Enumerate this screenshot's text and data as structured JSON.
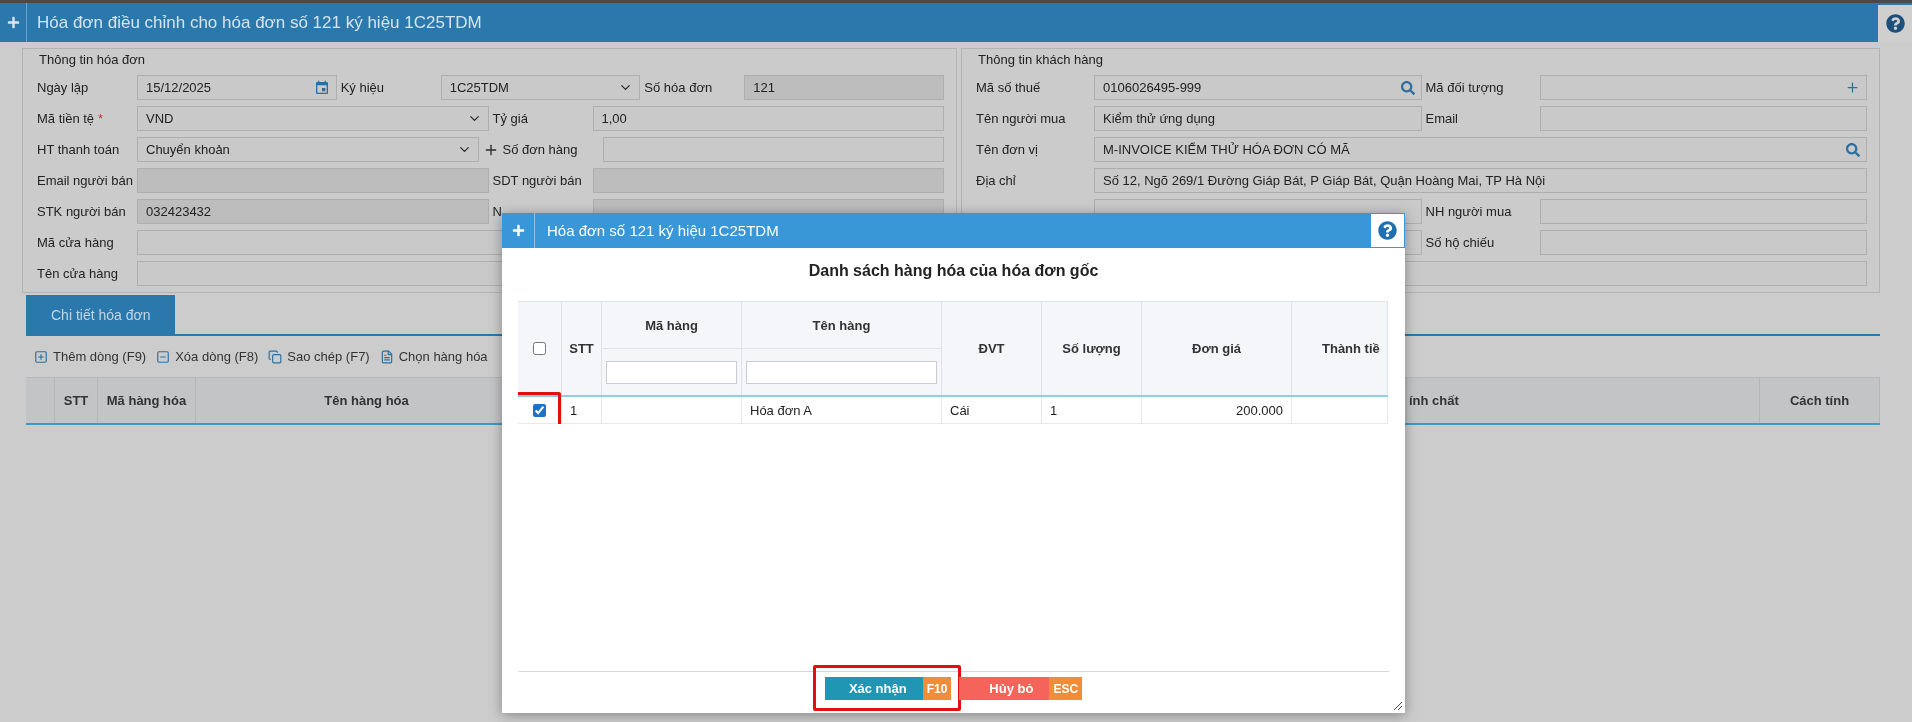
{
  "header": {
    "title": "Hóa đơn điều chỉnh cho hóa đơn số 121 ký hiệu 1C25TDM"
  },
  "invoice_info": {
    "legend": "Thông tin hóa đơn",
    "rows": [
      [
        {
          "label": "Ngày lập",
          "value": "15/12/2025",
          "kind": "date",
          "disabled": false
        },
        {
          "label": "Ký hiệu",
          "value": "1C25TDM",
          "kind": "select",
          "disabled": false
        },
        {
          "label": "Số hóa đơn",
          "value": "121",
          "kind": "text",
          "disabled": true
        }
      ],
      [
        {
          "label": "Mã tiền tệ",
          "required_mark": "*",
          "value": "VND",
          "kind": "select",
          "disabled": false
        },
        {
          "label": "Tỷ giá",
          "value": "1,00",
          "kind": "text",
          "disabled": false
        }
      ],
      [
        {
          "label": "HT thanh toán",
          "value": "Chuyển khoản",
          "kind": "select_add",
          "disabled": false
        },
        {
          "label": "Số đơn hàng",
          "kind": "text",
          "disabled": false
        }
      ],
      [
        {
          "label": "Email người bán",
          "kind": "text",
          "disabled": true
        },
        {
          "label": "SDT người bán",
          "kind": "text",
          "disabled": true
        }
      ],
      [
        {
          "label": "STK người bán",
          "value": "032423432",
          "kind": "text",
          "disabled": true
        },
        {
          "label": "N",
          "kind": "text",
          "disabled": true
        }
      ],
      [
        {
          "label": "Mã cửa hàng",
          "kind": "text",
          "disabled": false
        }
      ],
      [
        {
          "label": "Tên cửa hàng",
          "kind": "text",
          "disabled": false
        }
      ]
    ]
  },
  "customer_info": {
    "legend": "Thông tin khách hàng",
    "rows": [
      [
        {
          "label": "Mã số thuế",
          "value": "0106026495-999",
          "kind": "search",
          "disabled": false
        },
        {
          "label": "Mã đối tượng",
          "kind": "add",
          "disabled": false
        }
      ],
      [
        {
          "label": "Tên người mua",
          "value": "Kiểm thử ứng dụng",
          "kind": "text",
          "disabled": false
        },
        {
          "label": "Email",
          "kind": "text",
          "disabled": false
        }
      ],
      [
        {
          "label": "Tên đơn vị",
          "value": "M-INVOICE KIỂM THỬ HÓA ĐƠN CÓ MÃ",
          "kind": "search",
          "disabled": false
        }
      ],
      [
        {
          "label": "Địa chỉ",
          "value": "Số 12, Ngõ 269/1 Đường Giáp Bát, P Giáp Bát, Quận Hoàng Mai, TP Hà Nội",
          "kind": "text",
          "disabled": false
        }
      ],
      [
        {
          "kind": "text",
          "disabled": false
        },
        {
          "label": "NH người mua",
          "kind": "text",
          "disabled": false
        }
      ],
      [
        {
          "kind": "text",
          "disabled": false
        },
        {
          "label": "Số hộ chiếu",
          "kind": "text",
          "disabled": false
        }
      ],
      [
        {
          "kind": "text",
          "disabled": false
        }
      ]
    ]
  },
  "tabs": [
    {
      "label": "Chi tiết hóa đơn",
      "selected": true
    }
  ],
  "toolbar": [
    {
      "label": "Thêm dòng (F9)",
      "kind": "add"
    },
    {
      "label": "Xóa dòng (F8)",
      "kind": "remove"
    },
    {
      "label": "Sao chép (F7)",
      "kind": "copy"
    },
    {
      "label": "Chọn hàng hóa",
      "kind": "pick"
    }
  ],
  "grid_columns": [
    {
      "label": "STT"
    },
    {
      "label": "Mã hàng hóa"
    },
    {
      "label": "Tên hàng hóa"
    },
    {
      "label": "ính chất"
    },
    {
      "label": "Cách tính"
    }
  ],
  "dialog": {
    "title": "Hóa đơn số 121 ký hiệu 1C25TDM",
    "heading": "Danh sách hàng hóa của hóa đơn gốc",
    "all_checked": false,
    "columns": [
      {
        "label": "STT",
        "filter": false
      },
      {
        "label": "Mã hàng",
        "filter": true
      },
      {
        "label": "Tên hàng",
        "filter": true
      },
      {
        "label": "ĐVT",
        "filter": false
      },
      {
        "label": "Số lượng",
        "filter": false
      },
      {
        "label": "Đơn giá",
        "filter": false
      },
      {
        "label": "Thành tiề",
        "filter": false
      }
    ],
    "rows": [
      {
        "checked": true,
        "highlighted": true,
        "stt": "1",
        "ten_hang": "Hóa đơn A",
        "dvt": "Cái",
        "so_luong": "1",
        "don_gia": "200.000"
      }
    ],
    "buttons": [
      {
        "label": "Xác nhận",
        "shortcut": "F10",
        "kind": "confirm",
        "highlighted": true
      },
      {
        "label": "Hủy bỏ",
        "shortcut": "ESC",
        "kind": "cancel",
        "highlighted": false
      }
    ]
  }
}
